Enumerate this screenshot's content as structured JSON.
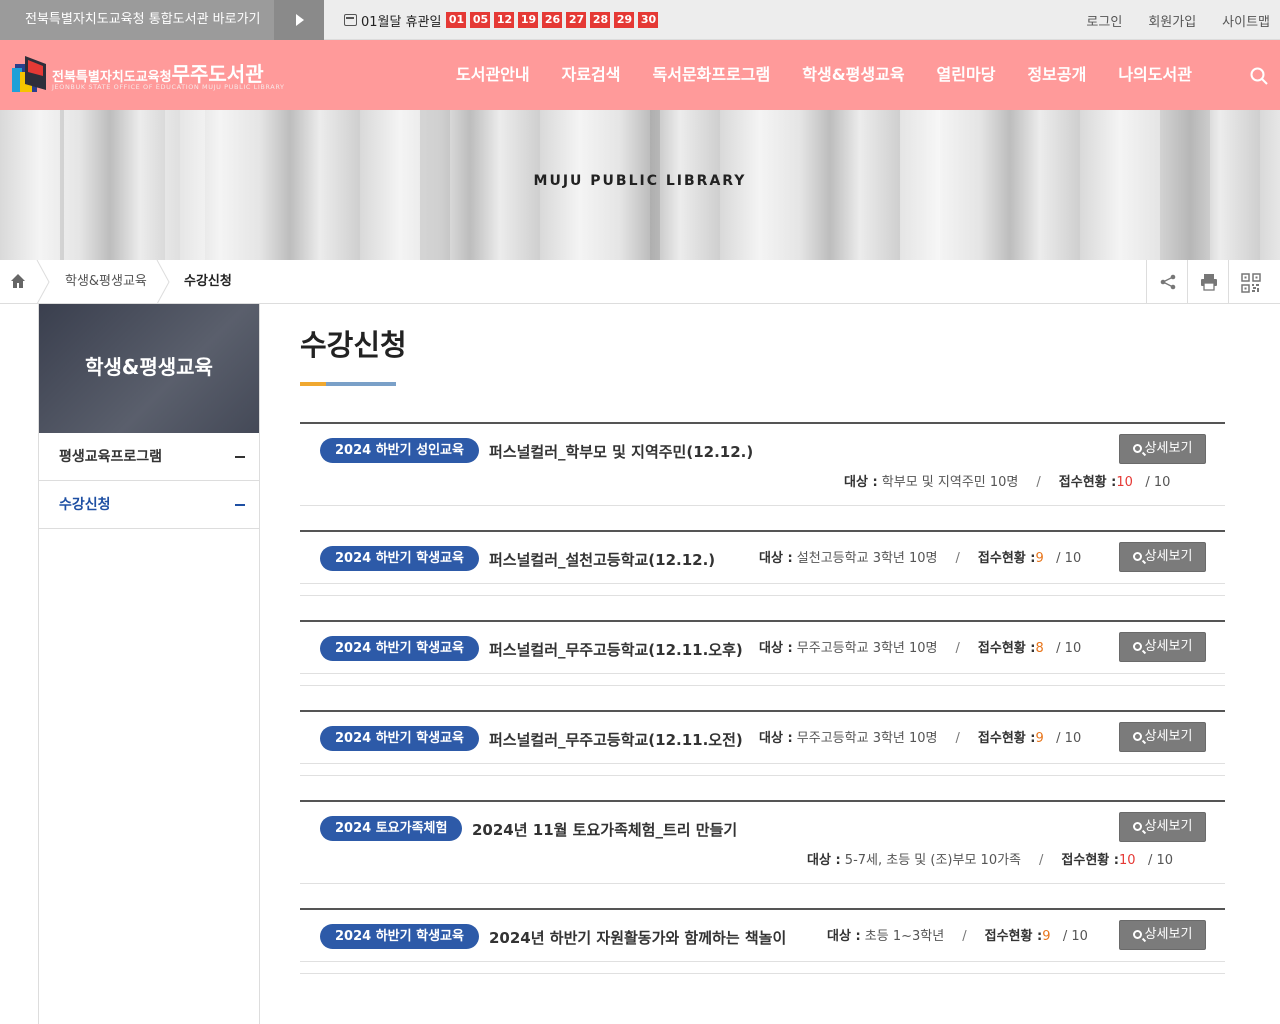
{
  "topbar": {
    "gov_link": "전북특별자치도교육청 통합도서관 바로가기",
    "closed_label": "01월달 휴관일",
    "closed_dates": [
      "01",
      "05",
      "12",
      "19",
      "26",
      "27",
      "28",
      "29",
      "30"
    ],
    "util_links": [
      "로그인",
      "회원가입",
      "사이트맵"
    ]
  },
  "header": {
    "logo_prefix": "전북특별자치도교육청",
    "logo_name": "무주도서관",
    "logo_sub": "JEONBUK STATE OFFICE OF EDUCATION MUJU PUBLIC LIBRARY",
    "menu": [
      "도서관안내",
      "자료검색",
      "독서문화프로그램",
      "학생&평생교육",
      "열린마당",
      "정보공개",
      "나의도서관"
    ]
  },
  "visual": {
    "title": "MUJU PUBLIC LIBRARY"
  },
  "breadcrumb": [
    "학생&평생교육",
    "수강신청"
  ],
  "sidebar": {
    "heading": "학생&평생교육",
    "items": [
      {
        "label": "평생교육프로그램",
        "active": false
      },
      {
        "label": "수강신청",
        "active": true
      }
    ]
  },
  "page": {
    "title": "수강신청"
  },
  "labels": {
    "target": "대상 :",
    "status": "접수현황 :",
    "detail": "상세보기"
  },
  "programs": [
    {
      "category": "2024 하반기 성인교육",
      "title": "퍼스널컬러_학부모 및 지역주민(12.12.)",
      "target": "학부모 및 지역주민 10명",
      "applied": "10",
      "capacity": "/ 10"
    },
    {
      "category": "2024 하반기 학생교육",
      "title": "퍼스널컬러_설천고등학교(12.12.)",
      "target": "설천고등학교 3학년 10명",
      "applied": "9",
      "capacity": "/ 10"
    },
    {
      "category": "2024 하반기 학생교육",
      "title": "퍼스널컬러_무주고등학교(12.11.오후)",
      "target": "무주고등학교 3학년 10명",
      "applied": "8",
      "capacity": "/ 10"
    },
    {
      "category": "2024 하반기 학생교육",
      "title": "퍼스널컬러_무주고등학교(12.11.오전)",
      "target": "무주고등학교 3학년 10명",
      "applied": "9",
      "capacity": "/ 10"
    },
    {
      "category": "2024 토요가족체험",
      "title": "2024년 11월 토요가족체험_트리 만들기",
      "target": "5-7세, 초등 및 (조)부모 10가족",
      "applied": "10",
      "capacity": "/ 10"
    },
    {
      "category": "2024 하반기 학생교육",
      "title": "2024년 하반기 자원활동가와 함께하는 책놀이",
      "target": "초등 1~3학년",
      "applied": "9",
      "capacity": "/ 10"
    }
  ],
  "colors": {
    "header_bg": "#ff9a9a",
    "badge_bg": "#2d5aa8",
    "full_count": "#e53935",
    "partial_count": "#e8761c",
    "closed_date": "#e53935"
  }
}
